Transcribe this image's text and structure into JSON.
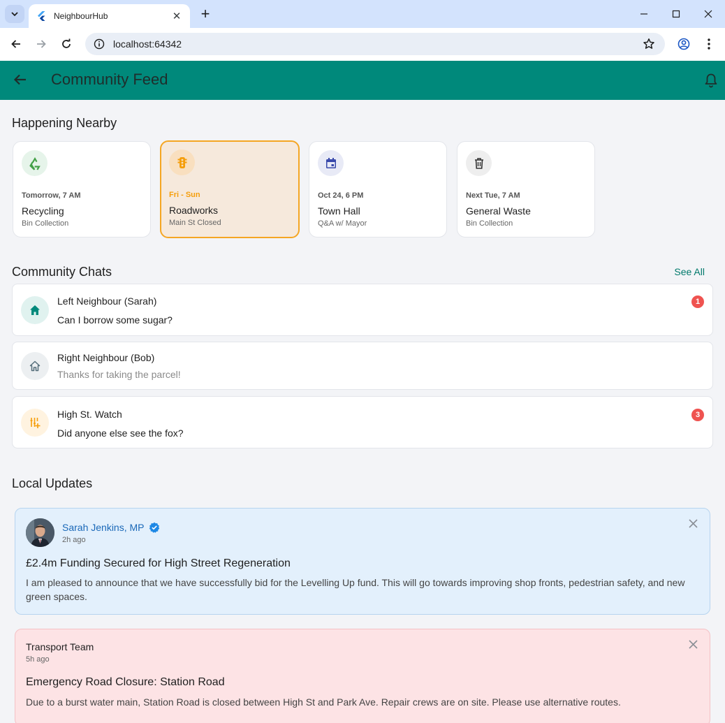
{
  "browser": {
    "tab_title": "NeighbourHub",
    "url": "localhost:64342"
  },
  "appbar": {
    "title": "Community Feed"
  },
  "nearby": {
    "title": "Happening Nearby",
    "cards": [
      {
        "when": "Tomorrow, 7 AM",
        "name": "Recycling",
        "sub": "Bin Collection",
        "icon": "recycle-icon",
        "icon_bg": "#e6f4ea",
        "icon_color": "#43a047"
      },
      {
        "when": "Fri - Sun",
        "name": "Roadworks",
        "sub": "Main St Closed",
        "icon": "traffic-light-icon",
        "icon_bg": "#f9dfbf",
        "icon_color": "#f59e0b",
        "selected": true
      },
      {
        "when": "Oct 24, 6 PM",
        "name": "Town Hall",
        "sub": "Q&A w/ Mayor",
        "icon": "calendar-icon",
        "icon_bg": "#e8eaf6",
        "icon_color": "#3949ab"
      },
      {
        "when": "Next Tue, 7 AM",
        "name": "General Waste",
        "sub": "Bin Collection",
        "icon": "trash-icon",
        "icon_bg": "#eeeeee",
        "icon_color": "#333333"
      }
    ]
  },
  "chats": {
    "title": "Community Chats",
    "see_all": "See All",
    "items": [
      {
        "name": "Left Neighbour (Sarah)",
        "message": "Can I borrow some sugar?",
        "unread": "1",
        "icon": "home-filled-icon"
      },
      {
        "name": "Right Neighbour (Bob)",
        "message": "Thanks for taking the parcel!",
        "unread": null,
        "icon": "home-outline-icon"
      },
      {
        "name": "High St. Watch",
        "message": "Did anyone else see the fox?",
        "unread": "3",
        "icon": "watch-group-icon"
      }
    ]
  },
  "updates": {
    "title": "Local Updates",
    "items": [
      {
        "author": "Sarah Jenkins, MP",
        "time": "2h ago",
        "headline": "£2.4m Funding Secured for High Street Regeneration",
        "body": "I am pleased to announce that we have successfully bid for the Levelling Up fund. This will go towards improving shop fronts, pedestrian safety, and new green spaces."
      },
      {
        "author": "Transport Team",
        "time": "5h ago",
        "headline": "Emergency Road Closure: Station Road",
        "body": "Due to a burst water main, Station Road is closed between High St and Park Ave. Repair crews are on site. Please use alternative routes."
      }
    ]
  },
  "colors": {
    "primary": "#00897b",
    "badge": "#ef5350",
    "selected_border": "#f5a623",
    "mp_link": "#1a68b8"
  }
}
